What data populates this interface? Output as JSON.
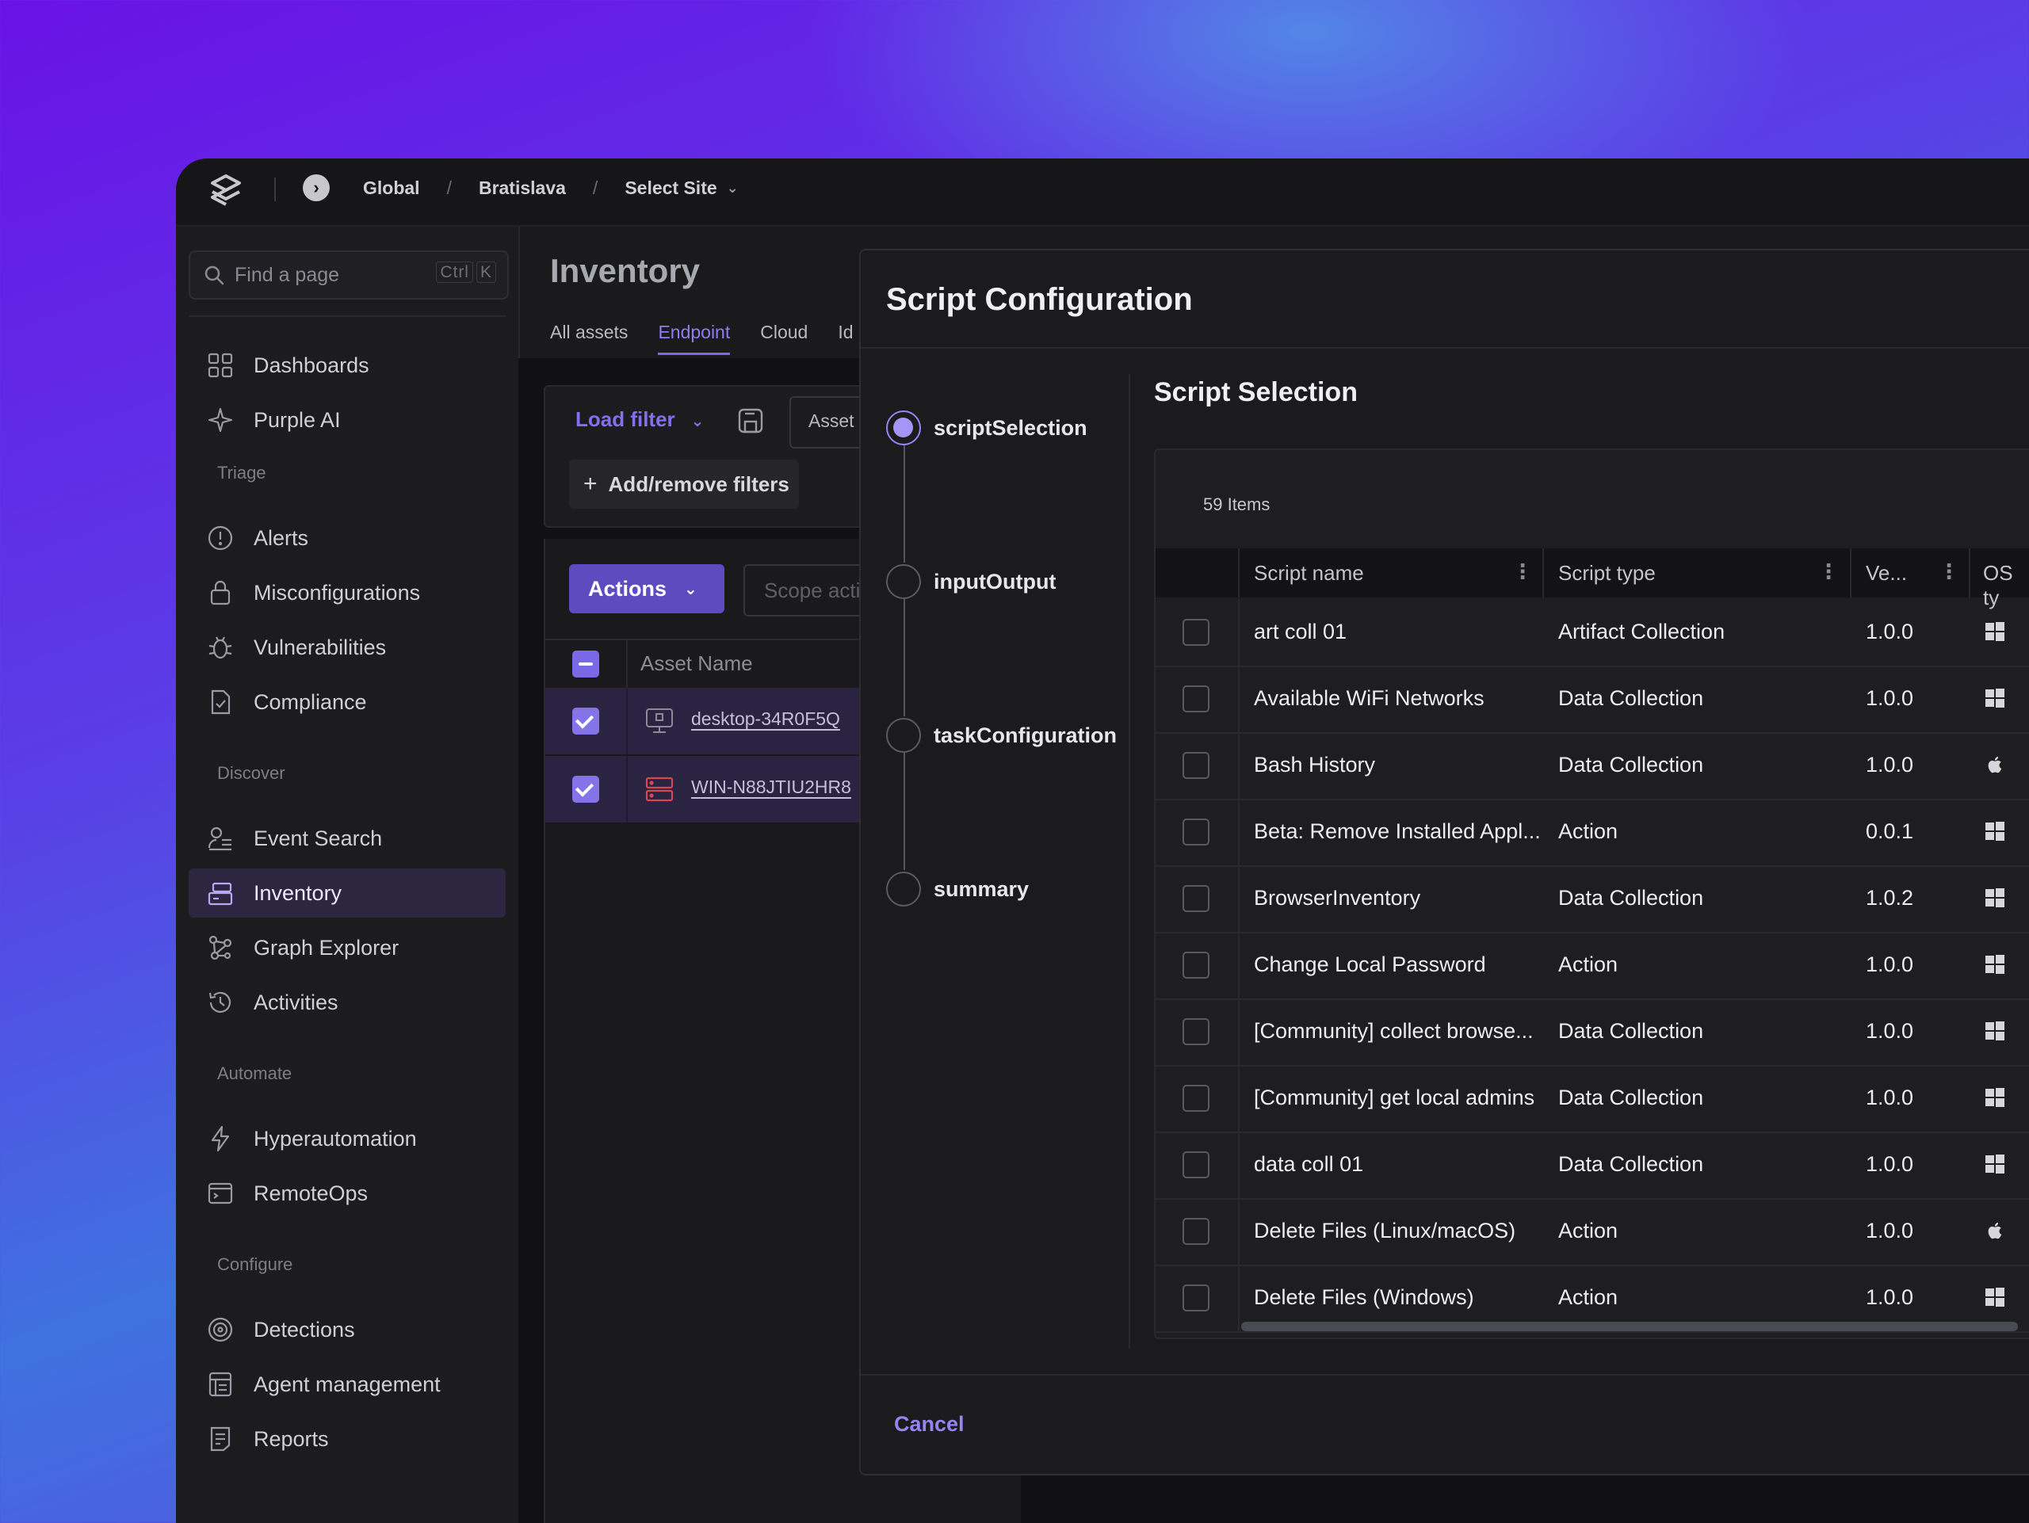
{
  "breadcrumb": {
    "items": [
      "Global",
      "Bratislava",
      "Select Site"
    ]
  },
  "sidebar": {
    "search_placeholder": "Find a page",
    "search_shortcut": [
      "Ctrl",
      "K"
    ],
    "top_items": [
      {
        "label": "Dashboards",
        "icon": "dashboard-icon"
      },
      {
        "label": "Purple AI",
        "icon": "sparkle-icon"
      }
    ],
    "sections": {
      "triage": {
        "title": "Triage",
        "items": [
          {
            "label": "Alerts",
            "icon": "alert-icon"
          },
          {
            "label": "Misconfigurations",
            "icon": "lock-icon"
          },
          {
            "label": "Vulnerabilities",
            "icon": "bug-icon"
          },
          {
            "label": "Compliance",
            "icon": "document-check-icon"
          }
        ]
      },
      "discover": {
        "title": "Discover",
        "items": [
          {
            "label": "Event Search",
            "icon": "event-search-icon"
          },
          {
            "label": "Inventory",
            "icon": "inventory-icon",
            "active": true
          },
          {
            "label": "Graph Explorer",
            "icon": "graph-icon"
          },
          {
            "label": "Activities",
            "icon": "history-icon"
          }
        ]
      },
      "automate": {
        "title": "Automate",
        "items": [
          {
            "label": "Hyperautomation",
            "icon": "bolt-icon"
          },
          {
            "label": "RemoteOps",
            "icon": "terminal-icon"
          }
        ]
      },
      "configure": {
        "title": "Configure",
        "items": [
          {
            "label": "Detections",
            "icon": "target-icon"
          },
          {
            "label": "Agent management",
            "icon": "agent-icon"
          },
          {
            "label": "Reports",
            "icon": "report-icon"
          }
        ]
      }
    }
  },
  "inventory": {
    "title": "Inventory",
    "tabs": [
      "All assets",
      "Endpoint",
      "Cloud",
      "Id"
    ],
    "active_tab": "Endpoint",
    "load_filter": "Load filter",
    "asset_filter": "Asset",
    "add_filters": "Add/remove filters",
    "actions": "Actions",
    "scope_placeholder": "Scope acti",
    "column_asset_name": "Asset Name",
    "assets": [
      "desktop-34R0F5Q",
      "WIN-N88JTIU2HR8"
    ]
  },
  "modal": {
    "title": "Script Configuration",
    "steps": [
      "scriptSelection",
      "inputOutput",
      "taskConfiguration",
      "summary"
    ],
    "active_step": "scriptSelection",
    "section_title": "Script Selection",
    "items_count": "59 Items",
    "columns": {
      "name": "Script name",
      "type": "Script type",
      "version": "Ve...",
      "os": "OS ty"
    },
    "rows": [
      {
        "name": "art coll 01",
        "type": "Artifact Collection",
        "version": "1.0.0",
        "os": "windows"
      },
      {
        "name": "Available WiFi Networks",
        "type": "Data Collection",
        "version": "1.0.0",
        "os": "windows"
      },
      {
        "name": "Bash History",
        "type": "Data Collection",
        "version": "1.0.0",
        "os": "macos"
      },
      {
        "name": "Beta: Remove Installed Appl...",
        "type": "Action",
        "version": "0.0.1",
        "os": "windows"
      },
      {
        "name": "BrowserInventory",
        "type": "Data Collection",
        "version": "1.0.2",
        "os": "windows"
      },
      {
        "name": "Change Local Password",
        "type": "Action",
        "version": "1.0.0",
        "os": "windows"
      },
      {
        "name": "[Community] collect browse...",
        "type": "Data Collection",
        "version": "1.0.0",
        "os": "windows"
      },
      {
        "name": "[Community] get local admins",
        "type": "Data Collection",
        "version": "1.0.0",
        "os": "windows"
      },
      {
        "name": "data coll 01",
        "type": "Data Collection",
        "version": "1.0.0",
        "os": "windows"
      },
      {
        "name": "Delete Files (Linux/macOS)",
        "type": "Action",
        "version": "1.0.0",
        "os": "macos"
      },
      {
        "name": "Delete Files (Windows)",
        "type": "Action",
        "version": "1.0.0",
        "os": "windows"
      }
    ],
    "cancel": "Cancel"
  },
  "colors": {
    "accent": "#7d66e8",
    "accent_text": "#9684f4",
    "background_gradient_start": "#6a12e6",
    "background_gradient_end": "#3f72e0",
    "panel": "#1b1b1e"
  }
}
